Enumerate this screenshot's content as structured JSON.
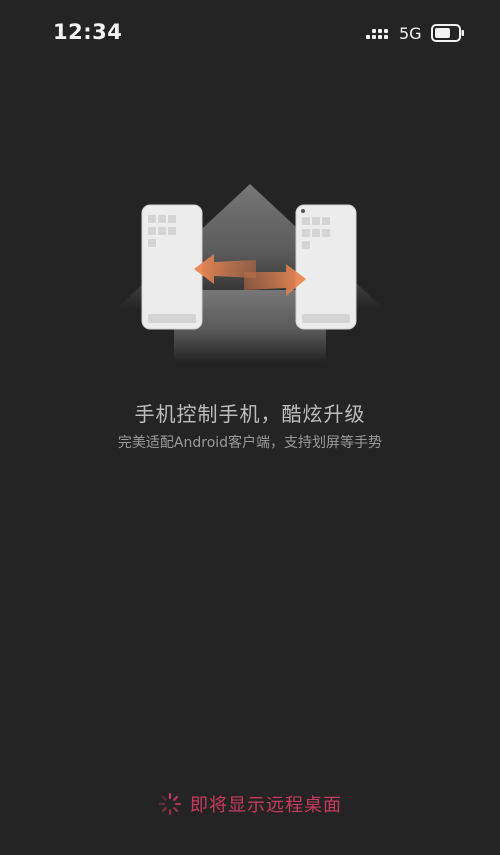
{
  "status_bar": {
    "time": "12:34",
    "network": "5G",
    "icons": [
      "signal-icon",
      "battery-icon"
    ]
  },
  "illustration": {
    "icons": [
      "house-icon",
      "phone-icon",
      "phone-icon",
      "swap-arrows-icon"
    ],
    "colors": {
      "arrow": "#e87a45",
      "phone": "#ececec",
      "house": "#6a6a6a"
    }
  },
  "intro": {
    "title": "手机控制手机，酷炫升级",
    "subtitle": "完美适配Android客户端，支持划屏等手势"
  },
  "loading": {
    "text": "即将显示远程桌面",
    "icon": "spinner-icon",
    "color": "#c93a5e"
  }
}
